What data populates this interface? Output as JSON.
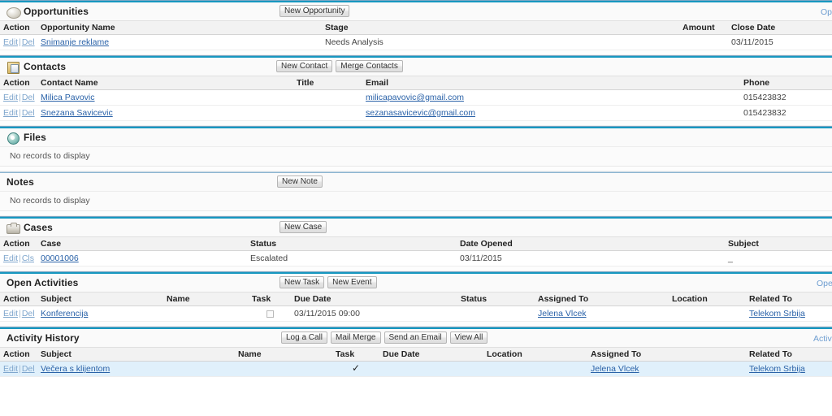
{
  "sections": [
    {
      "id": "opportunities",
      "title": "Opportunities",
      "icon": "opportunity-icon",
      "rule": "thick",
      "corner_link": "Opp",
      "buttons": [
        "New Opportunity"
      ],
      "columns": [
        "Action",
        "Opportunity Name",
        "Stage",
        "Amount",
        "Close Date"
      ],
      "rows": [
        {
          "actions": [
            "Edit",
            "Del"
          ],
          "name": "Snimanje reklame",
          "stage": "Needs Analysis",
          "amount": "",
          "close_date": "03/11/2015"
        }
      ]
    },
    {
      "id": "contacts",
      "title": "Contacts",
      "icon": "contacts-icon",
      "rule": "thick",
      "corner_link": "",
      "buttons": [
        "New Contact",
        "Merge Contacts"
      ],
      "columns": [
        "Action",
        "Contact Name",
        "Title",
        "Email",
        "Phone"
      ],
      "rows": [
        {
          "actions": [
            "Edit",
            "Del"
          ],
          "name": "Milica Pavovic",
          "title": "",
          "email": "milicapavovic@gmail.com",
          "phone": "015423832"
        },
        {
          "actions": [
            "Edit",
            "Del"
          ],
          "name": "Snezana Savicevic",
          "title": "",
          "email": "sezanasavicevic@gmail.com",
          "phone": "015423832"
        }
      ]
    },
    {
      "id": "files",
      "title": "Files",
      "icon": "files-icon",
      "rule": "thick",
      "corner_link": "",
      "buttons": [],
      "empty_message": "No records to display"
    },
    {
      "id": "notes",
      "title": "Notes",
      "icon": "none",
      "rule": "thin",
      "corner_link": "",
      "buttons": [
        "New Note"
      ],
      "empty_message": "No records to display"
    },
    {
      "id": "cases",
      "title": "Cases",
      "icon": "cases-icon",
      "rule": "thick",
      "corner_link": "",
      "buttons": [
        "New Case"
      ],
      "columns": [
        "Action",
        "Case",
        "Status",
        "Date Opened",
        "Subject"
      ],
      "rows": [
        {
          "actions": [
            "Edit",
            "Cls"
          ],
          "case_number": "00001006",
          "status": "Escalated",
          "date_opened": "03/11/2015",
          "subject": "_"
        }
      ]
    },
    {
      "id": "open-activities",
      "title": "Open Activities",
      "icon": "none",
      "rule": "thick",
      "corner_link": "Open",
      "buttons": [
        "New Task",
        "New Event"
      ],
      "columns": [
        "Action",
        "Subject",
        "Name",
        "Task",
        "Due Date",
        "Status",
        "Assigned To",
        "Location",
        "Related To"
      ],
      "rows": [
        {
          "actions": [
            "Edit",
            "Del"
          ],
          "subject": "Konferencija",
          "name": "",
          "task_checked": false,
          "due_date": "03/11/2015 09:00",
          "status": "",
          "assigned_to": "Jelena Vlcek",
          "location": "",
          "related_to": "Telekom Srbija"
        }
      ]
    },
    {
      "id": "activity-history",
      "title": "Activity History",
      "icon": "none",
      "rule": "thick",
      "corner_link": "Activ",
      "buttons": [
        "Log a Call",
        "Mail Merge",
        "Send an Email",
        "View All"
      ],
      "columns": [
        "Action",
        "Subject",
        "Name",
        "Task",
        "Due Date",
        "Location",
        "Assigned To",
        "Related To"
      ],
      "rows": [
        {
          "actions": [
            "Edit",
            "Del"
          ],
          "subject": "Večera s klijentom",
          "name": "",
          "task_checked": true,
          "due_date": "",
          "location": "",
          "assigned_to": "Jelena Vlcek",
          "related_to": "Telekom Srbija",
          "highlighted": true
        }
      ]
    }
  ],
  "colors": {
    "rule_blue": "#1797c0",
    "link_blue": "#2a62a8",
    "action_link": "#7fa6cd",
    "row_highlight": "#e0f0fb"
  }
}
